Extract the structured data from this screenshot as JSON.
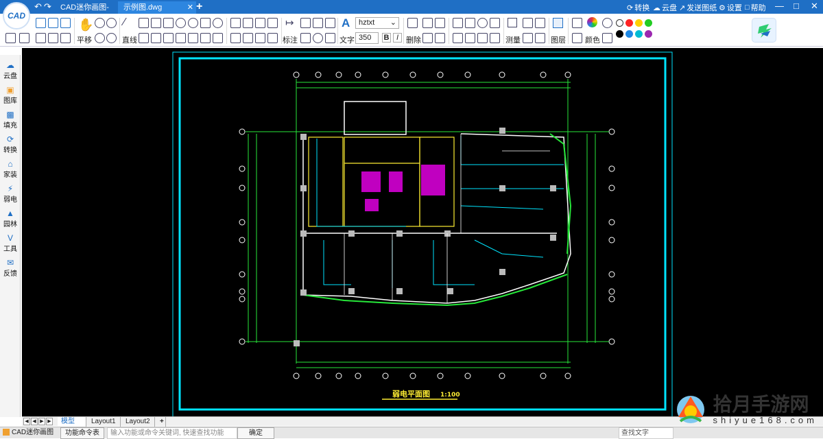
{
  "app": {
    "logo_text": "CAD",
    "name": "CAD迷你画图"
  },
  "tabs": [
    {
      "label": "CAD迷你画图-首页"
    },
    {
      "label": "示例图.dwg"
    }
  ],
  "title_right": {
    "convert": "转换",
    "cloud": "云盘",
    "send": "发送图纸",
    "settings": "设置",
    "help": "帮助"
  },
  "ribbon": {
    "pan": "平移",
    "line": "直线",
    "label": "标注",
    "text": "文字",
    "font_select": "hztxt",
    "size_select": "350",
    "bold": "B",
    "italic": "I",
    "delete": "删除",
    "measure": "测量",
    "layer": "图层",
    "color": "颜色"
  },
  "colors": [
    "#ffffff",
    "#ff2222",
    "#ffd000",
    "#22cc22",
    "#000000",
    "#1e88e5",
    "#00bcd4",
    "#9c27b0"
  ],
  "sidebar": [
    {
      "label": "云盘",
      "icon": "cloud-icon"
    },
    {
      "label": "图库",
      "icon": "gallery-icon"
    },
    {
      "label": "填充",
      "icon": "fill-icon"
    },
    {
      "label": "转换",
      "icon": "convert-icon"
    },
    {
      "label": "家装",
      "icon": "home-icon"
    },
    {
      "label": "弱电",
      "icon": "lightning-icon"
    },
    {
      "label": "园林",
      "icon": "tree-icon"
    },
    {
      "label": "工具",
      "icon": "tools-icon"
    },
    {
      "label": "反馈",
      "icon": "feedback-icon"
    }
  ],
  "drawing": {
    "title": "弱电平面图",
    "scale": "1:100"
  },
  "layout_tabs": [
    "模型",
    "Layout1",
    "Layout2"
  ],
  "status": {
    "app": "CAD迷你画图",
    "cmd_list": "功能命令表",
    "input_placeholder": "输入功能或命令关键词, 快速查找功能",
    "confirm": "确定",
    "search_text": "查找文字"
  },
  "watermark": {
    "line1": "拾月手游网",
    "line2": "shiyue168.com"
  }
}
